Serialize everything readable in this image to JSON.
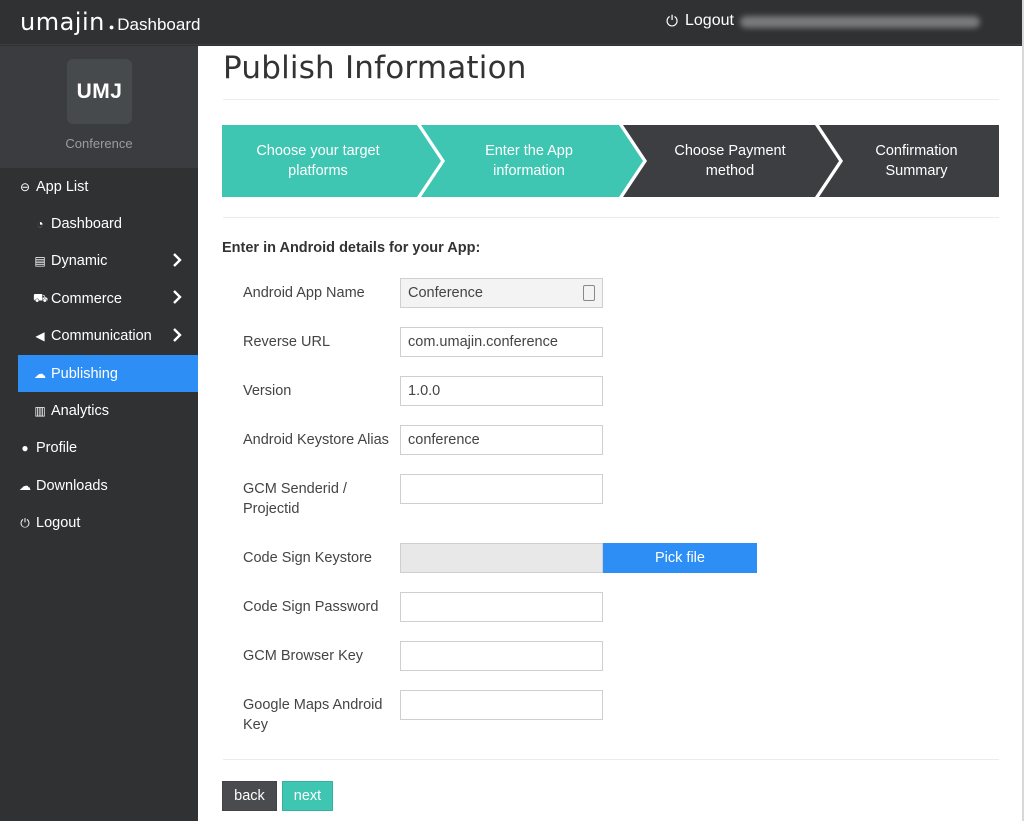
{
  "topbar": {
    "brand_logo": "umajin",
    "brand_dot": "●",
    "brand_sub": "Dashboard",
    "logout_label": "Logout",
    "power_icon": "power-icon"
  },
  "sidebar": {
    "avatar_text": "UMJ",
    "profile_name": "Conference",
    "items": [
      {
        "label": "App List",
        "icon": "arrow-circle-left-icon",
        "glyph": "⊖",
        "level": "top"
      },
      {
        "label": "Dashboard",
        "icon": "tachometer-icon",
        "glyph": "◔",
        "level": "sub"
      },
      {
        "label": "Dynamic",
        "icon": "archive-icon",
        "glyph": "▤",
        "level": "sub",
        "chevron": true
      },
      {
        "label": "Commerce",
        "icon": "truck-icon",
        "glyph": "⛟",
        "level": "sub",
        "chevron": true
      },
      {
        "label": "Communication",
        "icon": "bullhorn-icon",
        "glyph": "◀",
        "level": "sub",
        "chevron": true
      },
      {
        "label": "Publishing",
        "icon": "cloud-upload-icon",
        "glyph": "☁",
        "level": "sub",
        "active": true
      },
      {
        "label": "Analytics",
        "icon": "bar-chart-icon",
        "glyph": "▥",
        "level": "sub"
      },
      {
        "label": "Profile",
        "icon": "user-icon",
        "glyph": "●",
        "level": "top"
      },
      {
        "label": "Downloads",
        "icon": "cloud-download-icon",
        "glyph": "☁",
        "level": "top"
      },
      {
        "label": "Logout",
        "icon": "power-icon",
        "glyph": "⏻",
        "level": "top"
      }
    ]
  },
  "main": {
    "title": "Publish Information",
    "wizard_steps": [
      {
        "line1": "Choose your target",
        "line2": "platforms",
        "state": "done"
      },
      {
        "line1": "Enter the App",
        "line2": "information",
        "state": "current"
      },
      {
        "line1": "Choose Payment",
        "line2": "method",
        "state": "todo"
      },
      {
        "line1": "Confirmation",
        "line2": "Summary",
        "state": "todo"
      }
    ],
    "section_title": "Enter in Android details for your App:",
    "fields": {
      "app_name": {
        "label": "Android App Name",
        "value": "Conference"
      },
      "reverse_url": {
        "label": "Reverse URL",
        "value": "com.umajin.conference"
      },
      "version": {
        "label": "Version",
        "value": "1.0.0"
      },
      "keystore_alias": {
        "label": "Android Keystore Alias",
        "value": "conference"
      },
      "gcm_senderid": {
        "label_line1": "GCM Senderid /",
        "label_line2": "Projectid",
        "value": ""
      },
      "code_sign_keystore": {
        "label": "Code Sign Keystore",
        "button": "Pick file"
      },
      "code_sign_password": {
        "label": "Code Sign Password",
        "value": ""
      },
      "gcm_browser_key": {
        "label": "GCM Browser Key",
        "value": ""
      },
      "google_maps_key": {
        "label_line1": "Google Maps Android",
        "label_line2": "Key",
        "value": ""
      }
    },
    "buttons": {
      "back": "back",
      "next": "next"
    }
  },
  "colors": {
    "teal": "#3ec6b2",
    "dark_step": "#3c3e41",
    "active_blue": "#2d8ff5",
    "sidebar_bg": "#2f3133"
  }
}
